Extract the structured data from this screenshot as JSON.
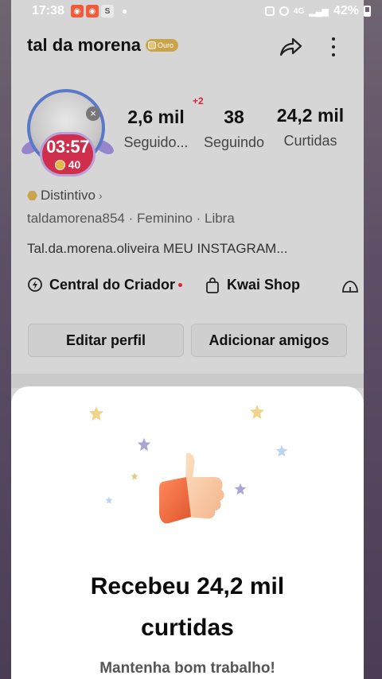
{
  "status_bar": {
    "time": "17:38",
    "battery": "42%",
    "network": "4G"
  },
  "profile": {
    "username": "tal da morena",
    "level_badge": "Ouro",
    "live_timer": "03:57",
    "coins": "40",
    "stats": [
      {
        "value": "2,6 mil",
        "label": "Seguido..."
      },
      {
        "value": "38",
        "label": "Seguindo"
      },
      {
        "value": "24,2 mil",
        "label": "Curtidas"
      }
    ],
    "following_badge": "+2",
    "distintivo_label": "Distintivo",
    "meta": "taldamorena854 · Feminino · Libra",
    "bio": "Tal.da.morena.oliveira MEU INSTAGRAM...",
    "links": [
      {
        "label": "Central do Criador",
        "icon": "lightning-icon"
      },
      {
        "label": "Kwai Shop",
        "icon": "shopping-bag-icon"
      }
    ],
    "buttons": {
      "edit": "Editar perfil",
      "add_friends": "Adicionar amigos"
    }
  },
  "sheet": {
    "title_line1": "Recebeu 24,2 mil",
    "title_line2": "curtidas",
    "subtitle": "Mantenha bom trabalho!",
    "icon": "thumbs-up-icon"
  },
  "colors": {
    "accent_red": "#d8243b",
    "live_pill": "#cf2f4c",
    "gold": "#c9a44a"
  }
}
